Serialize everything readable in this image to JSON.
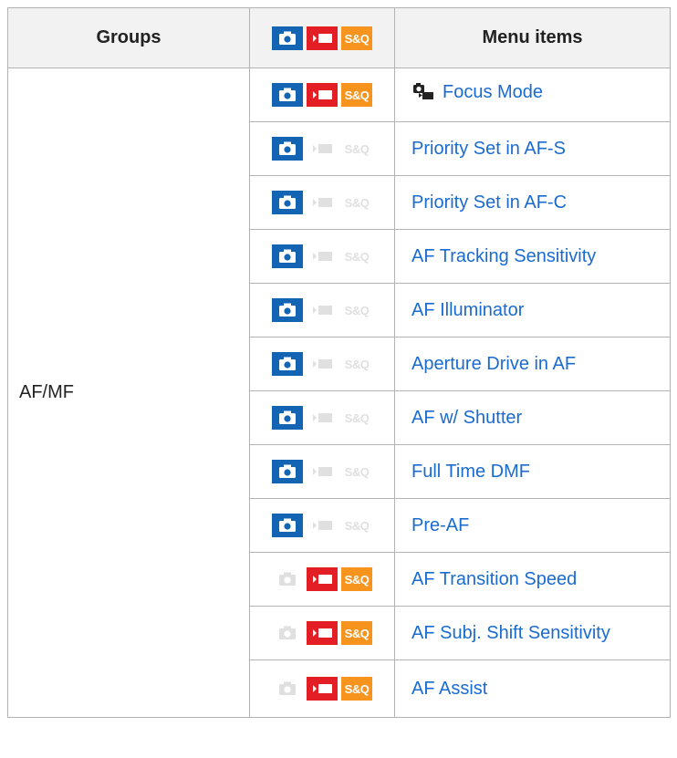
{
  "headers": {
    "groups": "Groups",
    "modes": [
      "photo-icon",
      "movie-icon",
      "s-and-q-icon"
    ],
    "menu_items": "Menu items"
  },
  "icons": {
    "photo_color": "#1464b4",
    "movie_color": "#e31e24",
    "sq_color": "#f7941d",
    "disabled_color": "#e0e0e0",
    "sq_label": "S&Q"
  },
  "group_name": "AF/MF",
  "rows": [
    {
      "label": "Focus Mode",
      "photo": true,
      "movie": true,
      "sq": true,
      "icon": "focus-mode-icon"
    },
    {
      "label": "Priority Set in AF-S",
      "photo": true,
      "movie": false,
      "sq": false
    },
    {
      "label": "Priority Set in AF-C",
      "photo": true,
      "movie": false,
      "sq": false
    },
    {
      "label": "AF Tracking Sensitivity",
      "photo": true,
      "movie": false,
      "sq": false
    },
    {
      "label": "AF Illuminator",
      "photo": true,
      "movie": false,
      "sq": false
    },
    {
      "label": "Aperture Drive in AF",
      "photo": true,
      "movie": false,
      "sq": false
    },
    {
      "label": "AF w/ Shutter",
      "photo": true,
      "movie": false,
      "sq": false
    },
    {
      "label": "Full Time DMF",
      "photo": true,
      "movie": false,
      "sq": false
    },
    {
      "label": "Pre-AF",
      "photo": true,
      "movie": false,
      "sq": false
    },
    {
      "label": "AF Transition Speed",
      "photo": false,
      "movie": true,
      "sq": true
    },
    {
      "label": "AF Subj. Shift Sensitivity",
      "photo": false,
      "movie": true,
      "sq": true
    },
    {
      "label": "AF Assist",
      "photo": false,
      "movie": true,
      "sq": true
    }
  ]
}
